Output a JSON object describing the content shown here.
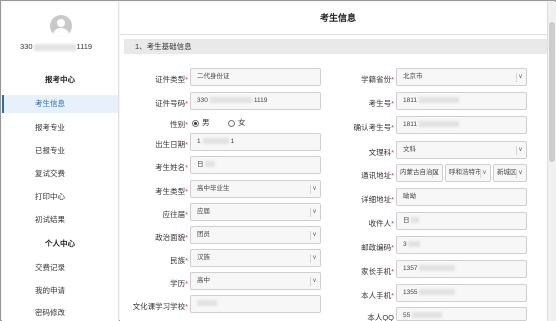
{
  "sidebar": {
    "user_id_prefix": "330",
    "user_id_suffix": "1119",
    "section1_title": "报考中心",
    "section1_items": [
      "考生信息",
      "报考专业",
      "已报专业",
      "复试交费",
      "打印中心",
      "初试结果"
    ],
    "section2_title": "个人中心",
    "section2_items": [
      "交费记录",
      "我的申请",
      "密码修改"
    ]
  },
  "page": {
    "title": "考生信息",
    "section_band": "1、考生基础信息"
  },
  "left_form": {
    "id_type": {
      "label": "证件类型",
      "value": "二代身份证"
    },
    "id_number": {
      "label": "证件号码",
      "prefix": "330",
      "suffix": "1119"
    },
    "gender": {
      "label": "性别",
      "options": [
        "男",
        "女"
      ],
      "selected": "男"
    },
    "birth": {
      "label": "出生日期",
      "prefix": "1",
      "suffix": "1"
    },
    "name": {
      "label": "考生姓名",
      "value": "日"
    },
    "candidate_type": {
      "label": "考生类型",
      "value": "高中毕业生"
    },
    "fresh": {
      "label": "应往届",
      "value": "应届"
    },
    "politics": {
      "label": "政治面貌",
      "value": "团员"
    },
    "ethnicity": {
      "label": "民族",
      "value": "汉族"
    },
    "education": {
      "label": "学历",
      "value": "高中"
    },
    "school": {
      "label": "文化课学习学校"
    }
  },
  "right_form": {
    "province": {
      "label": "学籍省份",
      "value": "北京市"
    },
    "exam_no": {
      "label": "考生号",
      "prefix": "1811"
    },
    "confirm_no": {
      "label": "确认考生号",
      "prefix": "1811"
    },
    "subject": {
      "label": "文理科",
      "value": "文科"
    },
    "address": {
      "label": "通讯地址",
      "values": [
        "内蒙古自治区",
        "呼和浩特市",
        "新城区"
      ]
    },
    "detail": {
      "label": "详细地址",
      "value": "呦呦"
    },
    "receiver": {
      "label": "收件人",
      "value": "日"
    },
    "postcode": {
      "label": "邮政编码",
      "prefix": "3"
    },
    "parent_phone": {
      "label": "家长手机",
      "prefix": "1357"
    },
    "own_phone": {
      "label": "本人手机",
      "prefix": "1355"
    },
    "qq": {
      "label": "本人QQ",
      "prefix": "55"
    }
  }
}
